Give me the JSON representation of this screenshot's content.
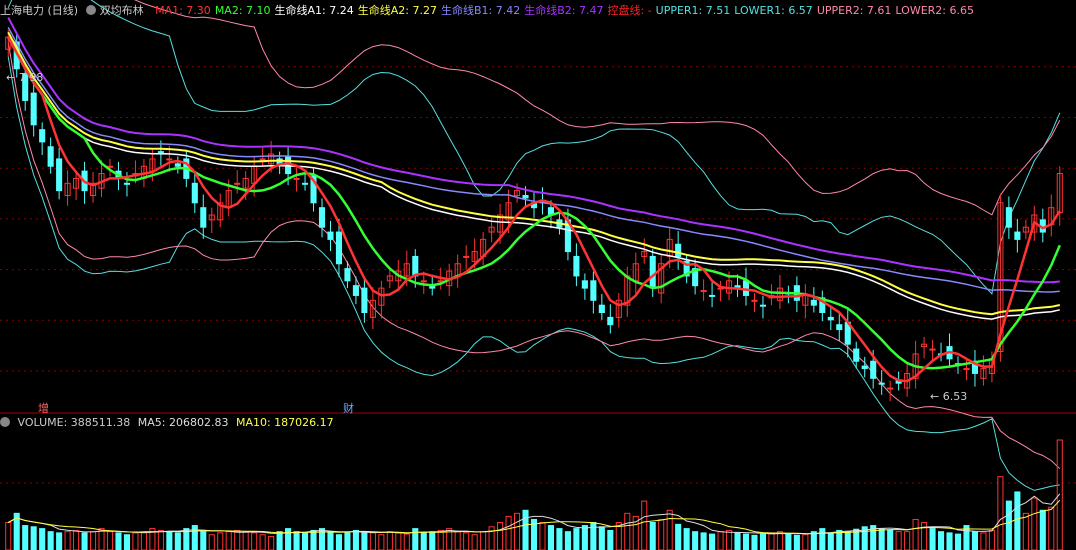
{
  "header": {
    "stock": "上海电力 (日线)",
    "indicator": "双均布林",
    "legend": [
      {
        "key": "ma1",
        "label": "MA1: 7.30",
        "color": "#ff3333"
      },
      {
        "key": "ma2",
        "label": "MA2: 7.10",
        "color": "#33ff33"
      },
      {
        "key": "a1",
        "label": "生命线A1: 7.24",
        "color": "#ffffff"
      },
      {
        "key": "a2",
        "label": "生命线A2: 7.27",
        "color": "#ffff44"
      },
      {
        "key": "b1",
        "label": "生命线B1: 7.42",
        "color": "#8888ff"
      },
      {
        "key": "b2",
        "label": "生命线B2: 7.47",
        "color": "#aa33ff"
      },
      {
        "key": "kp",
        "label": "控盘线: -",
        "color": "#ff2222"
      },
      {
        "key": "upper1",
        "label": "UPPER1: 7.51",
        "color": "#55e0e0"
      },
      {
        "key": "lower1",
        "label": "LOWER1: 6.57",
        "color": "#55e0e0"
      },
      {
        "key": "upper2",
        "label": "UPPER2: 7.61",
        "color": "#ff88aa"
      },
      {
        "key": "lower2",
        "label": "LOWER2: 6.65",
        "color": "#ff88aa"
      }
    ]
  },
  "price_marks": {
    "high": "7.98",
    "low": "6.53"
  },
  "event_marks": [
    {
      "label": "增",
      "color": "#ff6666"
    },
    {
      "label": "财",
      "color": "#66aaff"
    }
  ],
  "volume_header": {
    "volume": "VOLUME: 388511.38",
    "ma5": "MA5: 206802.83",
    "ma10": "MA10: 187026.17"
  },
  "colors": {
    "up": "#ff3333",
    "down": "#54ffff",
    "grid": "#8b0000",
    "bg": "#000000"
  },
  "chart_data": [
    {
      "type": "candlestick",
      "ylim": [
        6.45,
        8.05
      ],
      "close": [
        7.98,
        7.85,
        7.72,
        7.62,
        7.55,
        7.45,
        7.35,
        7.38,
        7.4,
        7.35,
        7.38,
        7.42,
        7.45,
        7.4,
        7.38,
        7.42,
        7.45,
        7.48,
        7.5,
        7.48,
        7.45,
        7.4,
        7.3,
        7.2,
        7.25,
        7.3,
        7.35,
        7.38,
        7.4,
        7.45,
        7.48,
        7.5,
        7.46,
        7.42,
        7.4,
        7.38,
        7.3,
        7.2,
        7.15,
        7.05,
        6.98,
        6.92,
        6.85,
        6.9,
        6.95,
        7.0,
        7.02,
        7.05,
        7.0,
        6.98,
        6.95,
        6.98,
        7.02,
        7.05,
        7.08,
        7.1,
        7.15,
        7.2,
        7.25,
        7.3,
        7.35,
        7.32,
        7.28,
        7.3,
        7.25,
        7.2,
        7.1,
        7.0,
        6.95,
        6.9,
        6.85,
        6.8,
        6.9,
        7.0,
        7.05,
        7.1,
        6.95,
        7.05,
        7.15,
        7.08,
        7.0,
        6.96,
        6.94,
        6.92,
        6.95,
        6.98,
        6.95,
        6.92,
        6.9,
        6.88,
        6.92,
        6.95,
        6.93,
        6.9,
        6.92,
        6.88,
        6.85,
        6.82,
        6.78,
        6.72,
        6.65,
        6.62,
        6.58,
        6.56,
        6.54,
        6.56,
        6.6,
        6.68,
        6.72,
        6.7,
        6.68,
        6.66,
        6.64,
        6.62,
        6.6,
        6.62,
        6.66,
        7.3,
        7.2,
        7.15,
        7.2,
        7.25,
        7.18,
        7.28,
        7.42
      ],
      "volume": [
        45,
        60,
        40,
        38,
        35,
        30,
        28,
        30,
        32,
        28,
        30,
        35,
        30,
        28,
        25,
        28,
        30,
        35,
        32,
        30,
        28,
        35,
        40,
        30,
        25,
        28,
        30,
        32,
        30,
        28,
        25,
        22,
        30,
        35,
        30,
        28,
        32,
        35,
        30,
        25,
        28,
        32,
        30,
        28,
        25,
        30,
        28,
        26,
        35,
        28,
        30,
        32,
        35,
        30,
        28,
        25,
        30,
        38,
        45,
        55,
        60,
        65,
        50,
        45,
        40,
        35,
        30,
        35,
        40,
        45,
        38,
        32,
        45,
        60,
        55,
        80,
        45,
        50,
        65,
        42,
        35,
        30,
        28,
        26,
        30,
        32,
        28,
        26,
        24,
        26,
        28,
        30,
        26,
        24,
        25,
        30,
        35,
        28,
        32,
        30,
        34,
        38,
        40,
        35,
        32,
        30,
        30,
        50,
        45,
        35,
        30,
        28,
        26,
        40,
        30,
        28,
        32,
        120,
        80,
        95,
        60,
        85,
        65,
        70,
        180
      ]
    }
  ]
}
